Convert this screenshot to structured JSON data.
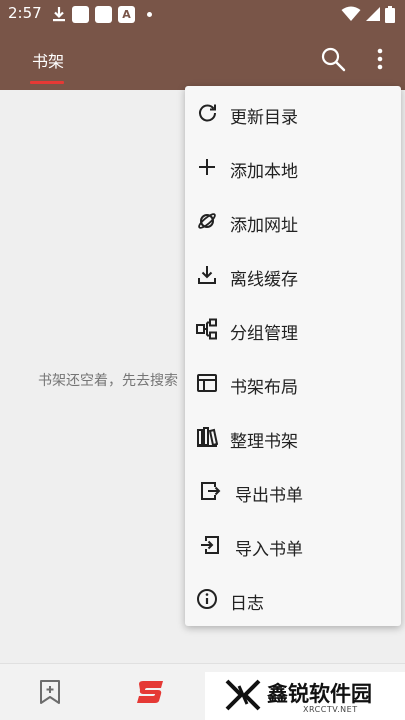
{
  "status_bar": {
    "time": "2:57",
    "a_icon_label": "A"
  },
  "app_bar": {
    "tab_label": "书架",
    "colors": {
      "toolbar": "#795548",
      "indicator": "#e53935"
    }
  },
  "content": {
    "empty_message": "书架还空着，先去搜索"
  },
  "menu": {
    "items": [
      {
        "label": "更新目录",
        "icon": "refresh-icon"
      },
      {
        "label": "添加本地",
        "icon": "plus-icon"
      },
      {
        "label": "添加网址",
        "icon": "planet-icon"
      },
      {
        "label": "离线缓存",
        "icon": "download-icon"
      },
      {
        "label": "分组管理",
        "icon": "group-icon"
      },
      {
        "label": "书架布局",
        "icon": "layout-icon"
      },
      {
        "label": "整理书架",
        "icon": "books-icon"
      },
      {
        "label": "导出书单",
        "icon": "export-icon"
      },
      {
        "label": "导入书单",
        "icon": "import-icon"
      },
      {
        "label": "日志",
        "icon": "info-icon"
      }
    ]
  },
  "watermark": {
    "name": "鑫锐软件园",
    "url": "XRCCTV.NET"
  }
}
